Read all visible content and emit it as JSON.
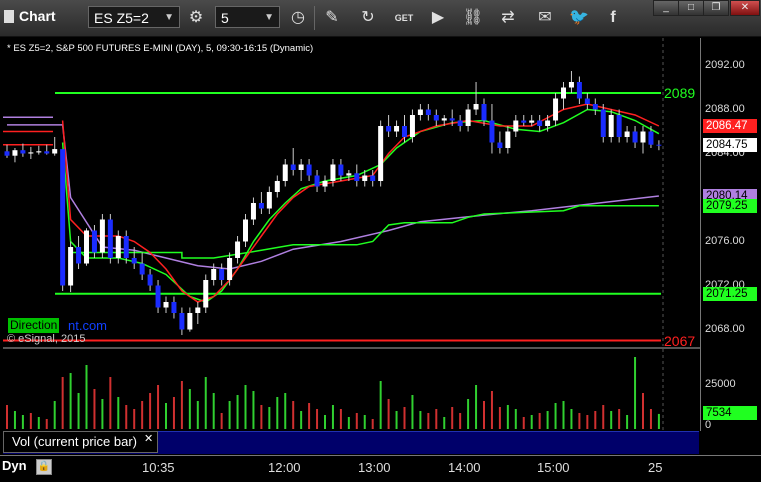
{
  "toolbar": {
    "title": "Chart",
    "symbol": "ES Z5=2",
    "interval": "5",
    "icons": [
      "clock-icon",
      "pencil-icon",
      "refresh-icon",
      "get-icon",
      "play-icon",
      "link-icon",
      "comment-icon",
      "twitter-icon",
      "facebook-icon"
    ]
  },
  "chart_header": "* ES Z5=2, S&P 500 FUTURES E-MINI (DAY), 5, 09:30-16:15 (Dynamic)",
  "copyright": "© eSignal, 2015",
  "direction_label": "Direction",
  "direction_tail": "nt.com",
  "price_axis": {
    "ticks": [
      "2092.00",
      "2088.00",
      "2084.00",
      "2080.00",
      "2076.00",
      "2072.00",
      "2068.00"
    ],
    "tags": [
      {
        "label": "2086.47",
        "bg": "#ff2020",
        "fg": "#ffffff"
      },
      {
        "label": "2084.75",
        "bg": "#ffffff",
        "fg": "#000000"
      },
      {
        "label": "2080.14",
        "bg": "#b080e0",
        "fg": "#000000"
      },
      {
        "label": "2079.25",
        "bg": "#20ff20",
        "fg": "#000000"
      },
      {
        "label": "2071.25",
        "bg": "#20ff20",
        "fg": "#000000"
      }
    ],
    "level_labels": [
      {
        "label": "2089",
        "color": "#20ff20"
      },
      {
        "label": "2067",
        "color": "#ff2020"
      }
    ]
  },
  "volume": {
    "title": "Vol (current price bar)",
    "tick": "25000",
    "zero": "0",
    "current": "7534"
  },
  "time_axis": {
    "labels": [
      "10:35",
      "12:00",
      "13:00",
      "14:00",
      "15:00",
      "25"
    ],
    "dyn": "Dyn"
  },
  "colors": {
    "level_green": "#20ff20",
    "level_red": "#ff2020",
    "ma_red": "#ff2020",
    "ma_green": "#20ff20",
    "vwap_purple": "#b080e0",
    "bull": "#ffffff",
    "bear": "#1a2cff",
    "vol_up": "#30d030",
    "vol_down": "#d03030"
  },
  "chart_data": {
    "type": "candlestick",
    "ylim": [
      2066.5,
      2094.5
    ],
    "horizontal_levels": [
      2089.5,
      2071.25,
      2067.0
    ],
    "candles": [
      [
        2084.2,
        2084.8,
        2083.6,
        2083.8
      ],
      [
        2083.8,
        2084.5,
        2083.2,
        2084.3
      ],
      [
        2084.3,
        2084.9,
        2083.7,
        2084.0
      ],
      [
        2084.0,
        2084.6,
        2083.5,
        2084.1
      ],
      [
        2084.1,
        2084.7,
        2083.9,
        2084.2
      ],
      [
        2084.2,
        2084.8,
        2083.9,
        2084.0
      ],
      [
        2084.0,
        2085.5,
        2083.8,
        2084.4
      ],
      [
        2084.4,
        2084.4,
        2071.5,
        2072.0
      ],
      [
        2072.0,
        2076.0,
        2071.4,
        2075.5
      ],
      [
        2075.5,
        2076.5,
        2073.5,
        2074.0
      ],
      [
        2074.0,
        2077.2,
        2073.8,
        2077.0
      ],
      [
        2077.0,
        2077.5,
        2074.5,
        2075.0
      ],
      [
        2075.0,
        2078.5,
        2074.5,
        2078.0
      ],
      [
        2078.0,
        2078.5,
        2074.0,
        2074.5
      ],
      [
        2074.5,
        2077.0,
        2074.0,
        2076.5
      ],
      [
        2076.5,
        2077.0,
        2074.0,
        2074.5
      ],
      [
        2074.5,
        2075.5,
        2073.5,
        2074.0
      ],
      [
        2074.0,
        2075.0,
        2072.5,
        2073.0
      ],
      [
        2073.0,
        2073.5,
        2071.5,
        2072.0
      ],
      [
        2072.0,
        2072.5,
        2069.5,
        2070.0
      ],
      [
        2070.0,
        2071.0,
        2069.5,
        2070.5
      ],
      [
        2070.5,
        2071.0,
        2069.0,
        2069.5
      ],
      [
        2069.5,
        2070.0,
        2067.5,
        2068.0
      ],
      [
        2068.0,
        2070.0,
        2067.8,
        2069.5
      ],
      [
        2069.5,
        2070.5,
        2068.5,
        2070.0
      ],
      [
        2070.0,
        2073.0,
        2069.5,
        2072.5
      ],
      [
        2072.5,
        2074.0,
        2072.0,
        2073.5
      ],
      [
        2073.5,
        2074.0,
        2072.0,
        2072.5
      ],
      [
        2072.5,
        2075.0,
        2072.0,
        2074.5
      ],
      [
        2074.5,
        2076.5,
        2074.0,
        2076.0
      ],
      [
        2076.0,
        2078.5,
        2075.5,
        2078.0
      ],
      [
        2078.0,
        2080.0,
        2077.5,
        2079.5
      ],
      [
        2079.5,
        2080.5,
        2078.5,
        2079.0
      ],
      [
        2079.0,
        2081.0,
        2078.5,
        2080.5
      ],
      [
        2080.5,
        2082.0,
        2080.0,
        2081.5
      ],
      [
        2081.5,
        2083.5,
        2081.0,
        2083.0
      ],
      [
        2083.0,
        2084.5,
        2082.0,
        2082.5
      ],
      [
        2082.5,
        2083.5,
        2081.5,
        2083.0
      ],
      [
        2083.0,
        2083.5,
        2081.5,
        2082.0
      ],
      [
        2082.0,
        2082.5,
        2080.5,
        2081.0
      ],
      [
        2081.0,
        2082.0,
        2080.5,
        2081.5
      ],
      [
        2081.5,
        2083.5,
        2081.0,
        2083.0
      ],
      [
        2083.0,
        2083.5,
        2081.5,
        2082.0
      ],
      [
        2082.0,
        2082.5,
        2081.5,
        2082.2
      ],
      [
        2082.2,
        2083.0,
        2081.0,
        2081.5
      ],
      [
        2081.5,
        2082.5,
        2081.0,
        2082.0
      ],
      [
        2082.0,
        2082.5,
        2081.0,
        2081.5
      ],
      [
        2081.5,
        2087.0,
        2081.0,
        2086.5
      ],
      [
        2086.5,
        2087.5,
        2085.5,
        2086.0
      ],
      [
        2086.0,
        2087.0,
        2085.5,
        2086.5
      ],
      [
        2086.5,
        2087.5,
        2085.0,
        2085.5
      ],
      [
        2085.5,
        2088.0,
        2085.0,
        2087.5
      ],
      [
        2087.5,
        2088.5,
        2087.0,
        2088.0
      ],
      [
        2088.0,
        2088.5,
        2087.0,
        2087.5
      ],
      [
        2087.5,
        2088.0,
        2086.5,
        2087.0
      ],
      [
        2087.0,
        2087.5,
        2086.5,
        2087.2
      ],
      [
        2087.2,
        2088.0,
        2086.5,
        2087.0
      ],
      [
        2087.0,
        2087.5,
        2086.0,
        2086.5
      ],
      [
        2086.5,
        2088.5,
        2086.0,
        2088.0
      ],
      [
        2088.0,
        2090.5,
        2087.5,
        2088.5
      ],
      [
        2088.5,
        2089.0,
        2086.5,
        2087.0
      ],
      [
        2087.0,
        2088.5,
        2084.0,
        2085.0
      ],
      [
        2085.0,
        2086.0,
        2084.0,
        2084.5
      ],
      [
        2084.5,
        2086.5,
        2084.0,
        2086.0
      ],
      [
        2086.0,
        2087.5,
        2085.5,
        2087.0
      ],
      [
        2087.0,
        2087.5,
        2086.5,
        2086.8
      ],
      [
        2086.8,
        2087.5,
        2086.5,
        2087.0
      ],
      [
        2087.0,
        2087.5,
        2086.0,
        2086.5
      ],
      [
        2086.5,
        2087.5,
        2086.0,
        2087.0
      ],
      [
        2087.0,
        2089.5,
        2086.5,
        2089.0
      ],
      [
        2089.0,
        2090.5,
        2088.0,
        2090.0
      ],
      [
        2090.0,
        2091.5,
        2089.5,
        2090.5
      ],
      [
        2090.5,
        2091.0,
        2088.5,
        2089.0
      ],
      [
        2089.0,
        2089.5,
        2088.0,
        2088.5
      ],
      [
        2088.5,
        2089.0,
        2087.5,
        2088.0
      ],
      [
        2088.0,
        2088.5,
        2085.0,
        2085.5
      ],
      [
        2085.5,
        2088.0,
        2085.0,
        2087.5
      ],
      [
        2087.5,
        2088.0,
        2085.0,
        2085.5
      ],
      [
        2085.5,
        2086.5,
        2085.0,
        2086.0
      ],
      [
        2086.0,
        2086.5,
        2084.5,
        2085.0
      ],
      [
        2085.0,
        2086.5,
        2084.0,
        2086.0
      ],
      [
        2086.0,
        2086.5,
        2084.5,
        2084.8
      ],
      [
        2084.8,
        2085.2,
        2084.3,
        2084.75
      ]
    ],
    "ma_red": [
      [
        7,
        2087.0
      ],
      [
        8,
        2078.0
      ],
      [
        10,
        2076.5
      ],
      [
        14,
        2076.5
      ],
      [
        16,
        2076.0
      ],
      [
        18,
        2075.0
      ],
      [
        20,
        2073.5
      ],
      [
        22,
        2071.5
      ],
      [
        24,
        2070.5
      ],
      [
        26,
        2071.0
      ],
      [
        28,
        2072.5
      ],
      [
        30,
        2074.5
      ],
      [
        32,
        2076.5
      ],
      [
        34,
        2078.5
      ],
      [
        36,
        2080.0
      ],
      [
        38,
        2081.0
      ],
      [
        42,
        2081.5
      ],
      [
        46,
        2082.0
      ],
      [
        48,
        2084.0
      ],
      [
        50,
        2085.5
      ],
      [
        54,
        2086.5
      ],
      [
        58,
        2087.0
      ],
      [
        62,
        2086.5
      ],
      [
        66,
        2086.5
      ],
      [
        70,
        2088.0
      ],
      [
        73,
        2088.5
      ],
      [
        76,
        2088.0
      ],
      [
        79,
        2087.5
      ],
      [
        82,
        2086.5
      ]
    ],
    "ma_green": [
      [
        7,
        2085.0
      ],
      [
        8,
        2076.0
      ],
      [
        10,
        2074.5
      ],
      [
        14,
        2074.5
      ],
      [
        17,
        2074.0
      ],
      [
        20,
        2073.0
      ],
      [
        23,
        2071.0
      ],
      [
        25,
        2070.5
      ],
      [
        27,
        2071.5
      ],
      [
        29,
        2073.5
      ],
      [
        31,
        2076.0
      ],
      [
        33,
        2078.0
      ],
      [
        35,
        2079.5
      ],
      [
        37,
        2080.8
      ],
      [
        40,
        2081.5
      ],
      [
        44,
        2082.0
      ],
      [
        47,
        2083.0
      ],
      [
        49,
        2084.5
      ],
      [
        52,
        2086.0
      ],
      [
        56,
        2086.8
      ],
      [
        60,
        2087.0
      ],
      [
        64,
        2086.2
      ],
      [
        67,
        2086.0
      ],
      [
        70,
        2086.8
      ],
      [
        73,
        2088.0
      ],
      [
        76,
        2087.8
      ],
      [
        79,
        2087.0
      ],
      [
        82,
        2085.8
      ]
    ],
    "vwap": [
      [
        0,
        2086.6
      ],
      [
        7,
        2086.6
      ],
      [
        8,
        2080.0
      ],
      [
        12,
        2075.5
      ],
      [
        16,
        2075.2
      ],
      [
        20,
        2074.5
      ],
      [
        24,
        2073.8
      ],
      [
        28,
        2073.5
      ],
      [
        32,
        2074.2
      ],
      [
        36,
        2075.3
      ],
      [
        42,
        2076.0
      ],
      [
        48,
        2077.0
      ],
      [
        52,
        2077.8
      ],
      [
        60,
        2078.4
      ],
      [
        66,
        2078.8
      ],
      [
        72,
        2079.3
      ],
      [
        78,
        2079.8
      ],
      [
        82,
        2080.14
      ]
    ],
    "ma_green_step": [
      [
        8,
        2075.0
      ],
      [
        22,
        2075.0
      ],
      [
        22,
        2074.5
      ],
      [
        26,
        2074.5
      ],
      [
        32,
        2075.2
      ],
      [
        36,
        2075.7
      ],
      [
        44,
        2075.7
      ],
      [
        46,
        2076.0
      ],
      [
        48,
        2077.5
      ],
      [
        50,
        2077.7
      ],
      [
        56,
        2077.7
      ],
      [
        58,
        2078.2
      ],
      [
        60,
        2078.5
      ],
      [
        70,
        2078.8
      ],
      [
        72,
        2079.25
      ],
      [
        82,
        2079.25
      ]
    ],
    "volume": [
      [
        0,
        12000,
        0
      ],
      [
        1,
        9000,
        1
      ],
      [
        2,
        7000,
        1
      ],
      [
        3,
        8000,
        0
      ],
      [
        4,
        6000,
        1
      ],
      [
        5,
        5000,
        0
      ],
      [
        6,
        14000,
        1
      ],
      [
        7,
        26000,
        0
      ],
      [
        8,
        28000,
        1
      ],
      [
        9,
        18000,
        1
      ],
      [
        10,
        32000,
        1
      ],
      [
        11,
        20000,
        0
      ],
      [
        12,
        15000,
        1
      ],
      [
        13,
        26000,
        0
      ],
      [
        14,
        16000,
        1
      ],
      [
        15,
        12000,
        0
      ],
      [
        16,
        10000,
        0
      ],
      [
        17,
        14000,
        0
      ],
      [
        18,
        18000,
        0
      ],
      [
        19,
        22000,
        0
      ],
      [
        20,
        13000,
        1
      ],
      [
        21,
        16000,
        0
      ],
      [
        22,
        24000,
        0
      ],
      [
        23,
        20000,
        1
      ],
      [
        24,
        14000,
        1
      ],
      [
        25,
        26000,
        1
      ],
      [
        26,
        18000,
        1
      ],
      [
        27,
        8000,
        0
      ],
      [
        28,
        14000,
        1
      ],
      [
        29,
        17000,
        1
      ],
      [
        30,
        22000,
        1
      ],
      [
        31,
        19000,
        1
      ],
      [
        32,
        12000,
        0
      ],
      [
        33,
        11000,
        1
      ],
      [
        34,
        16000,
        1
      ],
      [
        35,
        18000,
        1
      ],
      [
        36,
        14000,
        0
      ],
      [
        37,
        9000,
        1
      ],
      [
        38,
        13000,
        0
      ],
      [
        39,
        10000,
        0
      ],
      [
        40,
        7000,
        1
      ],
      [
        41,
        12000,
        1
      ],
      [
        42,
        10000,
        0
      ],
      [
        43,
        6000,
        1
      ],
      [
        44,
        8000,
        0
      ],
      [
        45,
        7000,
        1
      ],
      [
        46,
        5000,
        0
      ],
      [
        47,
        24000,
        1
      ],
      [
        48,
        15000,
        0
      ],
      [
        49,
        9000,
        1
      ],
      [
        50,
        11000,
        0
      ],
      [
        51,
        17000,
        1
      ],
      [
        52,
        9000,
        1
      ],
      [
        53,
        8000,
        0
      ],
      [
        54,
        10000,
        0
      ],
      [
        55,
        6000,
        1
      ],
      [
        56,
        11000,
        0
      ],
      [
        57,
        8000,
        0
      ],
      [
        58,
        15000,
        1
      ],
      [
        59,
        22000,
        1
      ],
      [
        60,
        14000,
        0
      ],
      [
        61,
        19000,
        0
      ],
      [
        62,
        11000,
        0
      ],
      [
        63,
        12000,
        1
      ],
      [
        64,
        10000,
        1
      ],
      [
        65,
        6000,
        0
      ],
      [
        66,
        7000,
        1
      ],
      [
        67,
        8000,
        0
      ],
      [
        68,
        9000,
        1
      ],
      [
        69,
        13000,
        1
      ],
      [
        70,
        14000,
        1
      ],
      [
        71,
        10000,
        1
      ],
      [
        72,
        8000,
        0
      ],
      [
        73,
        7000,
        0
      ],
      [
        74,
        9000,
        0
      ],
      [
        75,
        12000,
        0
      ],
      [
        76,
        9000,
        1
      ],
      [
        77,
        10000,
        0
      ],
      [
        78,
        7000,
        1
      ],
      [
        79,
        36000,
        1
      ],
      [
        80,
        18000,
        0
      ],
      [
        81,
        10000,
        0
      ],
      [
        82,
        7534,
        1
      ]
    ],
    "volume_ylim": [
      0,
      40000
    ]
  }
}
